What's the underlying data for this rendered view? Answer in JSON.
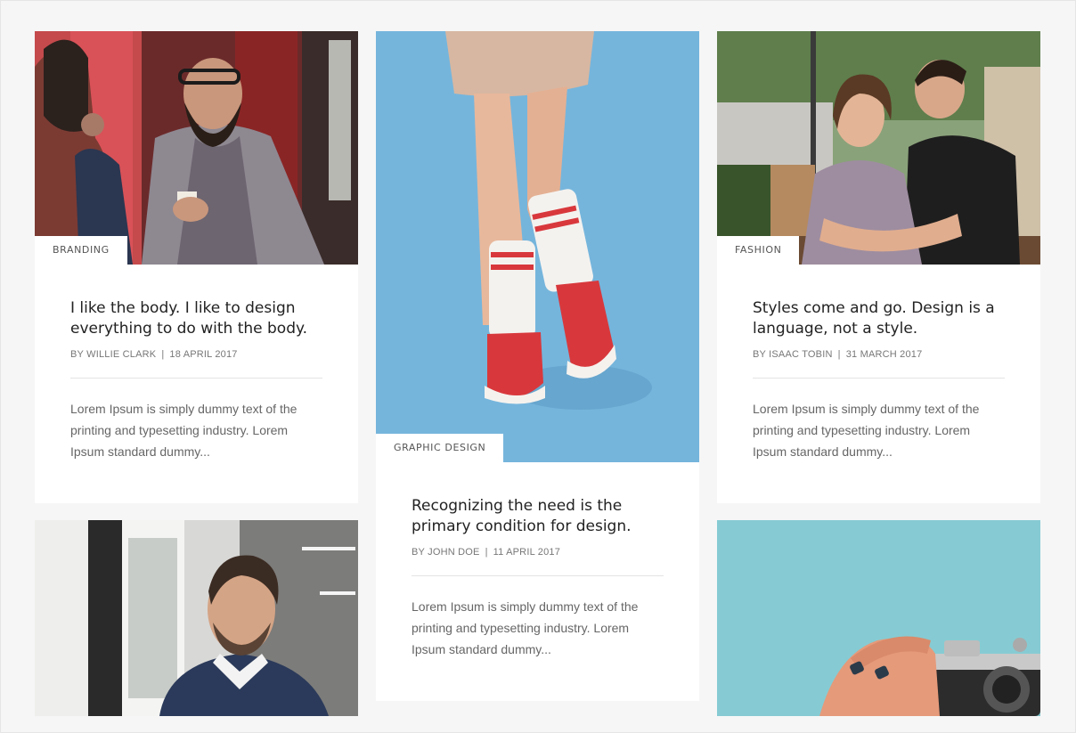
{
  "posts": [
    {
      "category": "BRANDING",
      "title": "I like the body. I like to design everything to do with the body.",
      "author": "BY WILLIE CLARK",
      "date": "18 APRIL 2017",
      "excerpt": "Lorem Ipsum is simply dummy text of the printing and typesetting industry. Lorem Ipsum standard dummy..."
    },
    {
      "category": "GRAPHIC DESIGN",
      "title": "Recognizing the need is the primary condition for design.",
      "author": "BY JOHN DOE",
      "date": "11 APRIL 2017",
      "excerpt": "Lorem Ipsum is simply dummy text of the printing and typesetting industry. Lorem Ipsum standard dummy..."
    },
    {
      "category": "FASHION",
      "title": "Styles come and go. Design is a language, not a style.",
      "author": "BY ISAAC TOBIN",
      "date": "31 MARCH 2017",
      "excerpt": "Lorem Ipsum is simply dummy text of the printing and typesetting industry. Lorem Ipsum standard dummy..."
    }
  ],
  "meta_separator": "|",
  "colors": {
    "page_bg": "#f6f6f6",
    "card_bg": "#ffffff",
    "text_dark": "#222222",
    "text_muted": "#666666",
    "photo_blue": "#7ab8de",
    "photo_teal": "#86cbd3"
  }
}
